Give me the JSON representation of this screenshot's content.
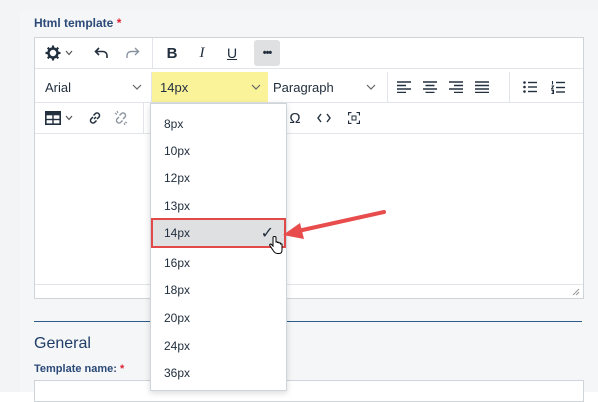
{
  "form": {
    "html_template_label": "Html template",
    "required_mark": "*",
    "general_title": "General",
    "template_name_label": "Template name:"
  },
  "toolbar": {
    "font_family": "Arial",
    "font_size": "14px",
    "block_format": "Paragraph",
    "bold": "B",
    "italic": "I",
    "underline": "U",
    "more": "•••"
  },
  "font_sizes": [
    "8px",
    "10px",
    "12px",
    "13px",
    "14px",
    "16px",
    "18px",
    "20px",
    "24px",
    "36px"
  ],
  "selected_font_size": "14px",
  "colors": {
    "highlight": "#fbf39a",
    "selected_border": "#e24a4a",
    "arrow": "#e84c4c",
    "label": "#2b4a78"
  }
}
